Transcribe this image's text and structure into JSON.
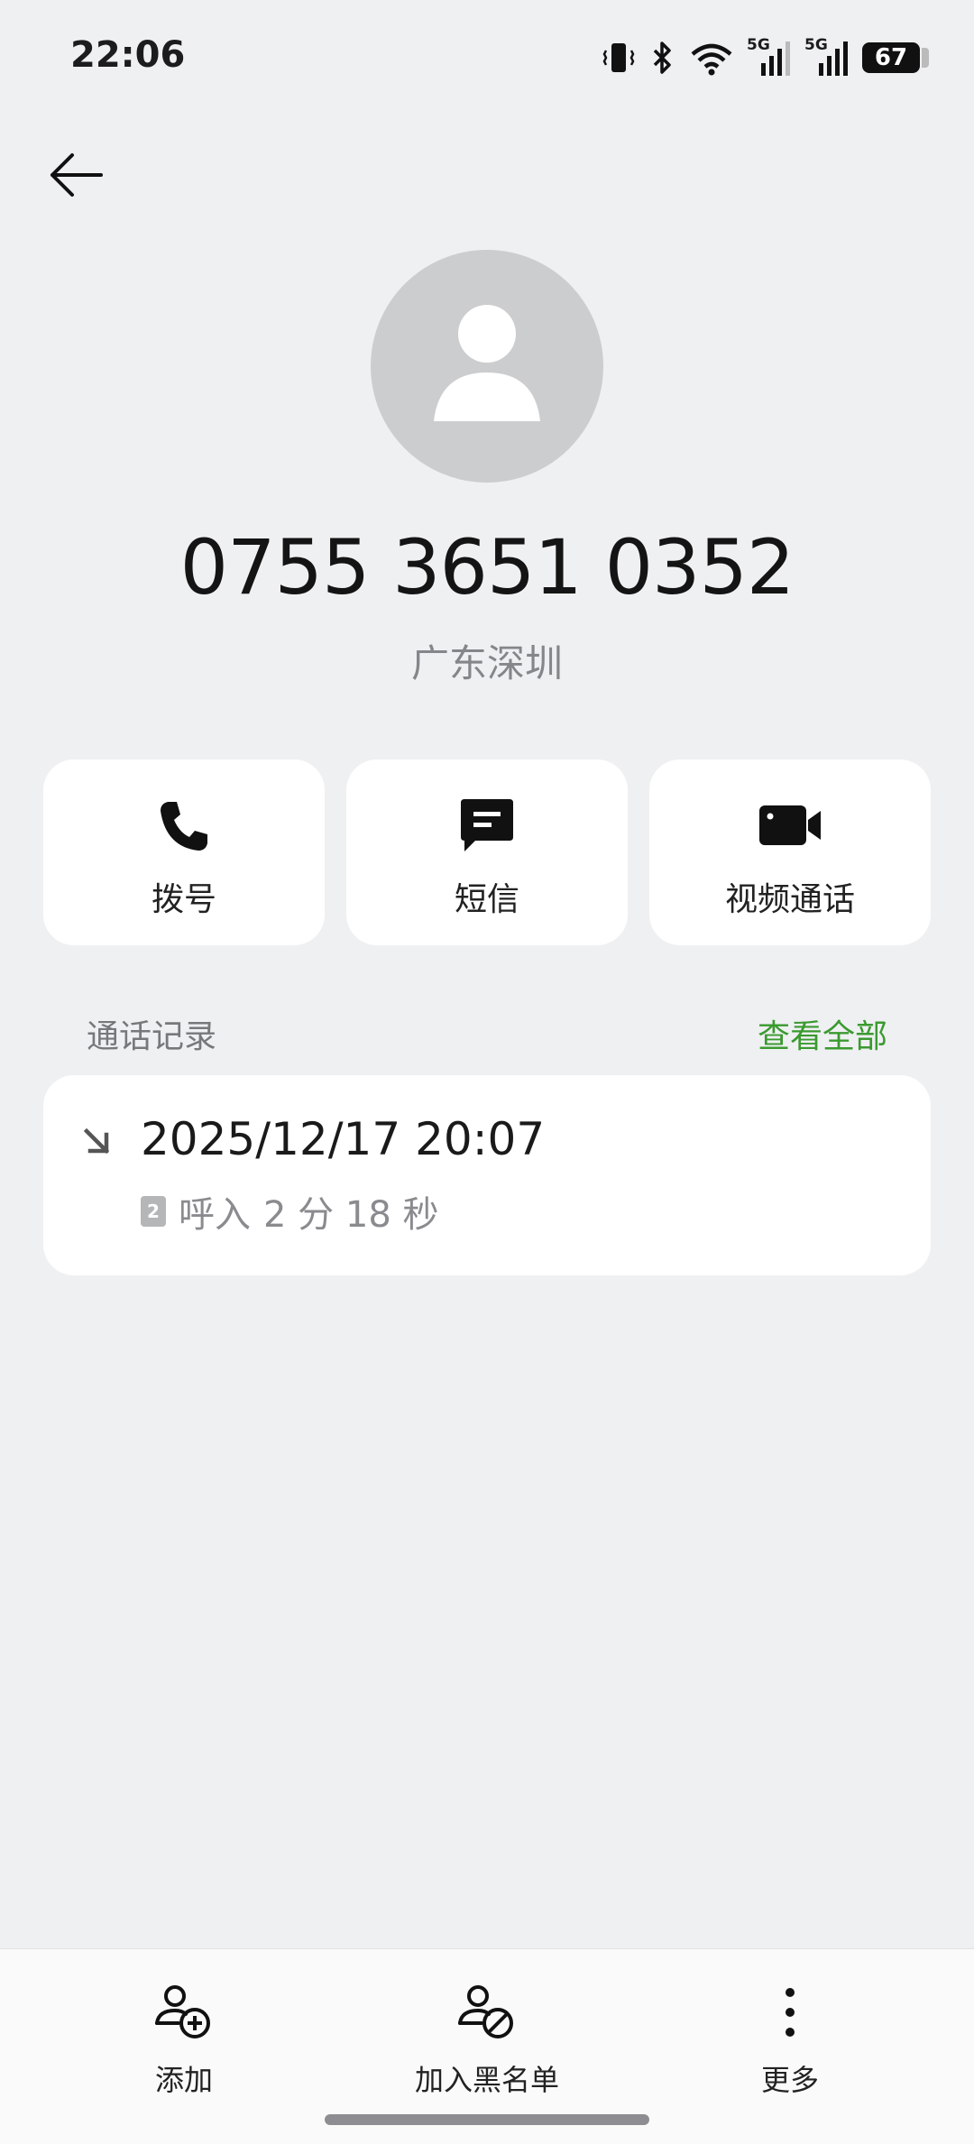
{
  "status_bar": {
    "time": "22:06",
    "network_1": "5G",
    "network_2": "5G",
    "battery": "67",
    "icons": [
      "vibrate-icon",
      "bluetooth-icon",
      "wifi-icon",
      "signal-5g-icon",
      "signal-5g-icon",
      "battery-icon"
    ]
  },
  "contact": {
    "number": "0755 3651 0352",
    "location": "广东深圳"
  },
  "actions": {
    "dial": "拨号",
    "sms": "短信",
    "video": "视频通话"
  },
  "call_log": {
    "title": "通话记录",
    "view_all": "查看全部",
    "entries": [
      {
        "datetime": "2025/12/17 20:07",
        "sim": "2",
        "type": "呼入",
        "duration": "2 分 18 秒"
      }
    ]
  },
  "bottom_nav": {
    "add": "添加",
    "block": "加入黑名单",
    "more": "更多"
  },
  "colors": {
    "background": "#eff0f2",
    "card": "#ffffff",
    "accent_green": "#3a9a2f",
    "avatar_bg": "#cccdcf"
  }
}
